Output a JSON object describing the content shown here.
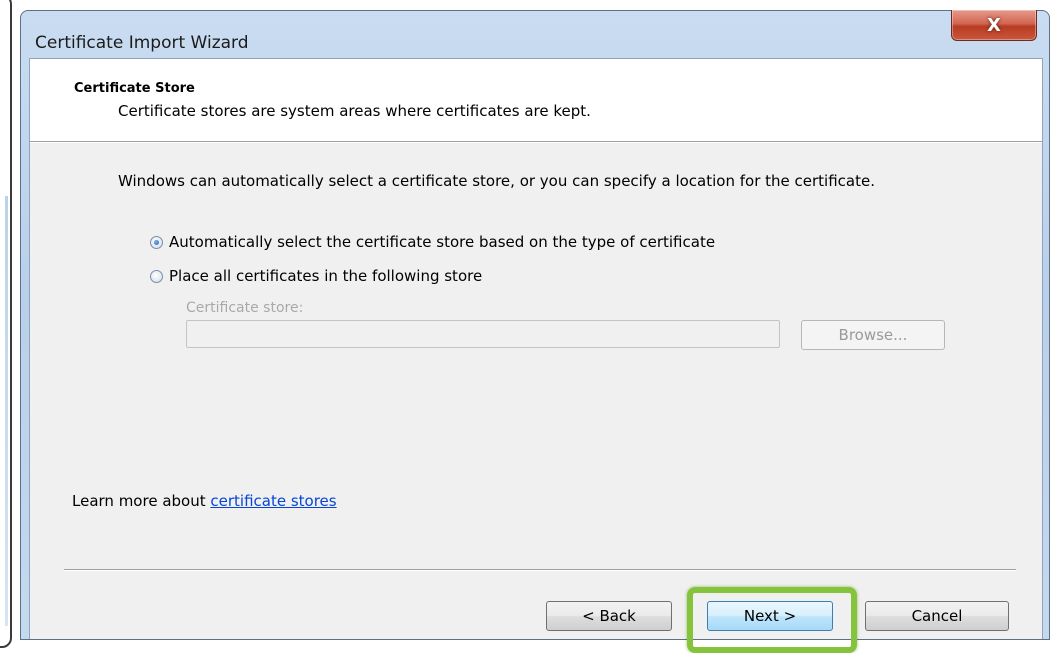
{
  "window": {
    "title": "Certificate Import Wizard",
    "close_label": "X"
  },
  "header": {
    "title": "Certificate Store",
    "description": "Certificate stores are system areas where certificates are kept."
  },
  "body": {
    "intro": "Windows can automatically select a certificate store, or you can specify a location for the certificate.",
    "options": [
      {
        "label": "Automatically select the certificate store based on the type of certificate",
        "selected": true
      },
      {
        "label": "Place all certificates in the following store",
        "selected": false
      }
    ],
    "store_label": "Certificate store:",
    "store_value": "",
    "browse_label": "Browse..."
  },
  "learn_more": {
    "prefix": "Learn more about ",
    "link": "certificate stores"
  },
  "buttons": {
    "back": "< Back",
    "next": "Next >",
    "cancel": "Cancel"
  },
  "colors": {
    "highlight": "#86c33c",
    "link": "#0645d6",
    "close": "#c9583d"
  }
}
